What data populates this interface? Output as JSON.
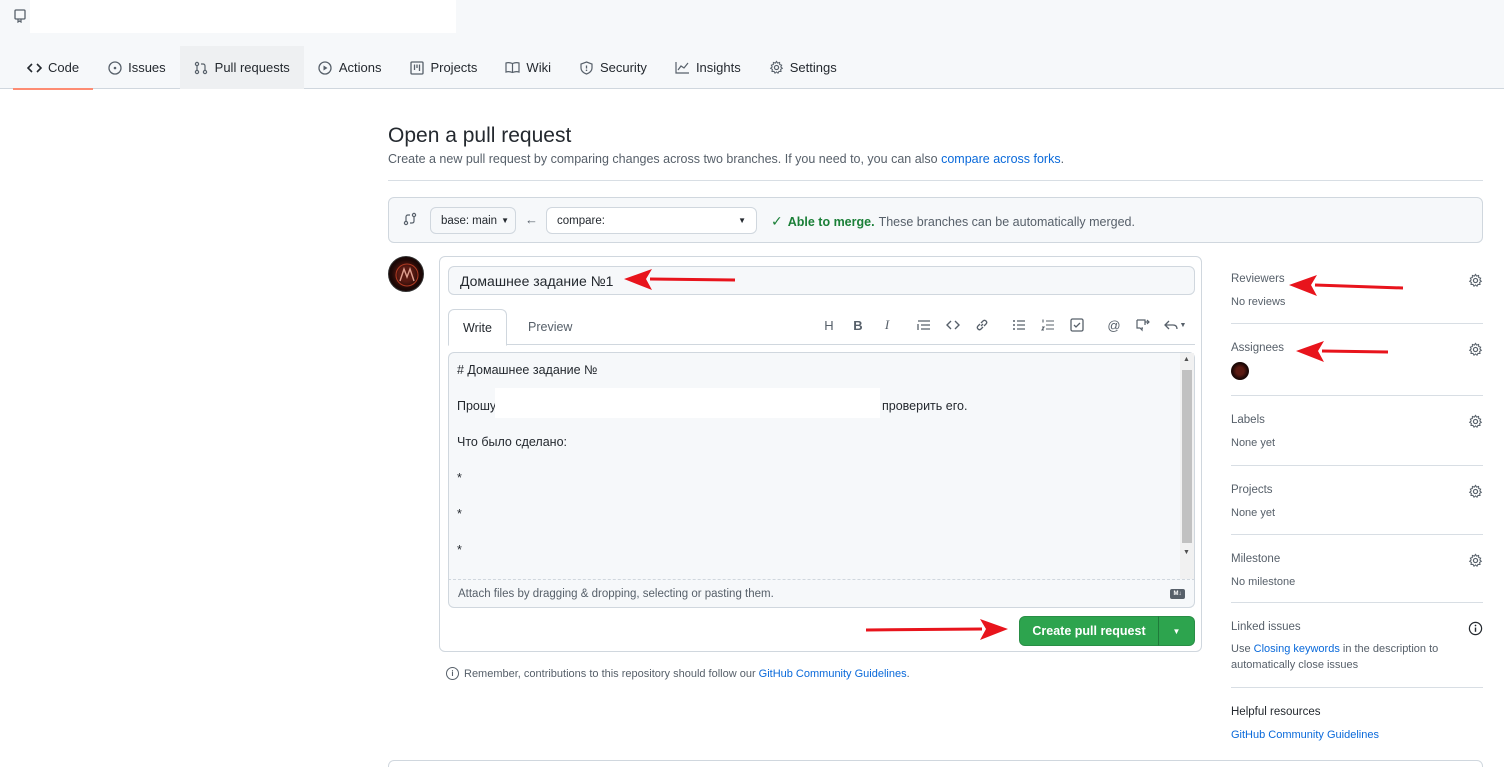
{
  "nav": {
    "tabs": [
      {
        "label": "Code",
        "icon": "code-icon"
      },
      {
        "label": "Issues",
        "icon": "issue-icon"
      },
      {
        "label": "Pull requests",
        "icon": "pull-request-icon"
      },
      {
        "label": "Actions",
        "icon": "play-icon"
      },
      {
        "label": "Projects",
        "icon": "project-icon"
      },
      {
        "label": "Wiki",
        "icon": "book-icon"
      },
      {
        "label": "Security",
        "icon": "shield-icon"
      },
      {
        "label": "Insights",
        "icon": "graph-icon"
      },
      {
        "label": "Settings",
        "icon": "gear-icon"
      }
    ]
  },
  "page": {
    "title": "Open a pull request",
    "subtitle": "Create a new pull request by comparing changes across two branches. If you need to, you can also ",
    "subtitle_link": "compare across forks",
    "subtitle_end": "."
  },
  "range": {
    "base_label": "base: ",
    "base_branch": "main",
    "compare_label": "compare:",
    "merge_ok": "Able to merge.",
    "merge_text": "These branches can be automatically merged."
  },
  "form": {
    "title_value": "Домашнее задание №1",
    "tab_write": "Write",
    "tab_preview": "Preview",
    "body_lines": [
      "# Домашнее задание №",
      "Прошу",
      "проверить его.",
      "Что было сделано:",
      "*",
      "*",
      "*"
    ],
    "attach_text": "Attach files by dragging & dropping, selecting or pasting them.",
    "md_badge": "M↓",
    "submit_label": "Create pull request"
  },
  "remember": {
    "text": "Remember, contributions to this repository should follow our",
    "link": "GitHub Community Guidelines",
    "end": "."
  },
  "sidebar": {
    "reviewers": {
      "title": "Reviewers",
      "value": "No reviews"
    },
    "assignees": {
      "title": "Assignees"
    },
    "labels": {
      "title": "Labels",
      "value": "None yet"
    },
    "projects": {
      "title": "Projects",
      "value": "None yet"
    },
    "milestone": {
      "title": "Milestone",
      "value": "No milestone"
    },
    "linked": {
      "title": "Linked issues",
      "pre": "Use ",
      "link": "Closing keywords",
      "post": " in the description to",
      "line2": "automatically close issues"
    },
    "helpful": {
      "title": "Helpful resources",
      "link": "GitHub Community Guidelines"
    }
  },
  "colors": {
    "accent_green": "#2da44e",
    "link_blue": "#0969da",
    "tab_underline": "#fd8c73",
    "annotation_arrow": "#e8141c"
  }
}
